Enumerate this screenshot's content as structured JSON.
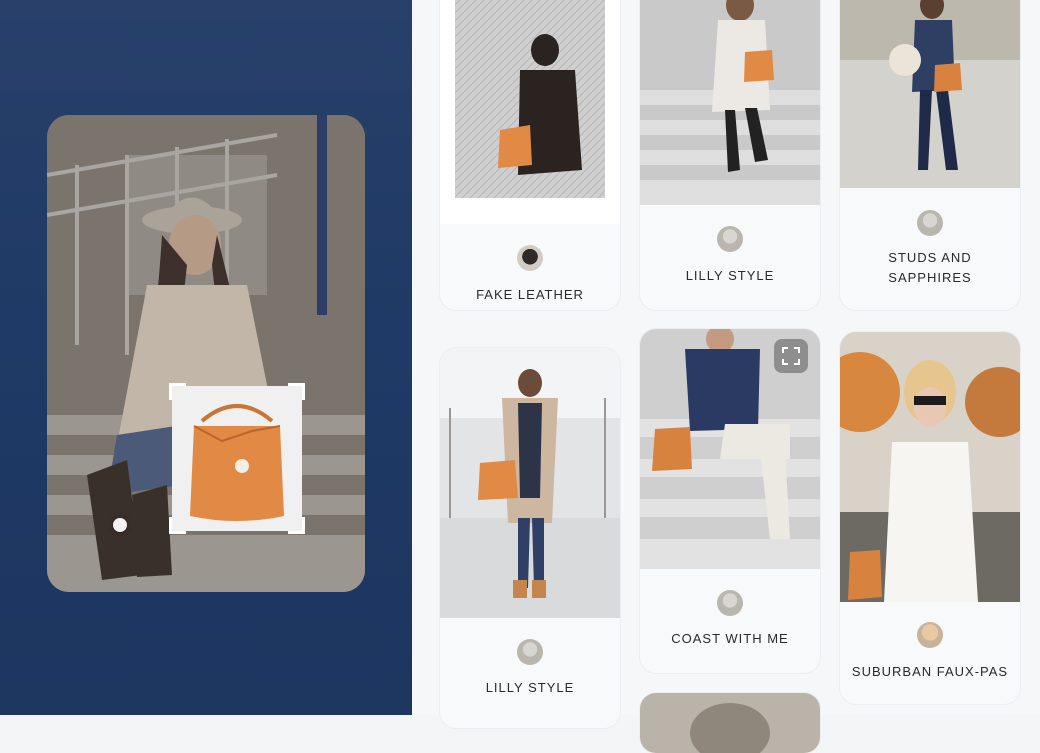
{
  "pins": [
    {
      "label": "FAKE LEATHER"
    },
    {
      "label": "LILLY STYLE"
    },
    {
      "label": "STUDS AND SAPPHIRES"
    },
    {
      "label": "LILLY STYLE"
    },
    {
      "label": "COAST WITH ME"
    },
    {
      "label": "SUBURBAN FAUX-PAS"
    }
  ],
  "colors": {
    "accent_bag": "#e08a45",
    "left_bg": "#22396a"
  },
  "icons": {
    "expand": "expand-icon"
  }
}
